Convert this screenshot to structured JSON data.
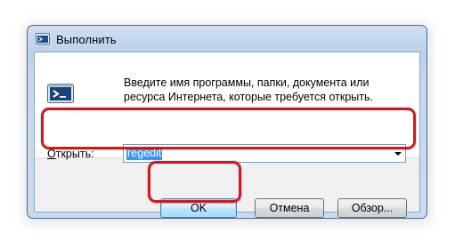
{
  "dialog": {
    "title": "Выполнить",
    "description": "Введите имя программы, папки, документа или ресурса Интернета, которые требуется открыть.",
    "open_label_underlined": "О",
    "open_label_rest": "ткрыть:",
    "input_value": "regedit",
    "buttons": {
      "ok": "OK",
      "cancel": "Отмена",
      "browse": "Обзор..."
    }
  },
  "colors": {
    "highlight": "#d4161c",
    "selection": "#3399ff"
  }
}
